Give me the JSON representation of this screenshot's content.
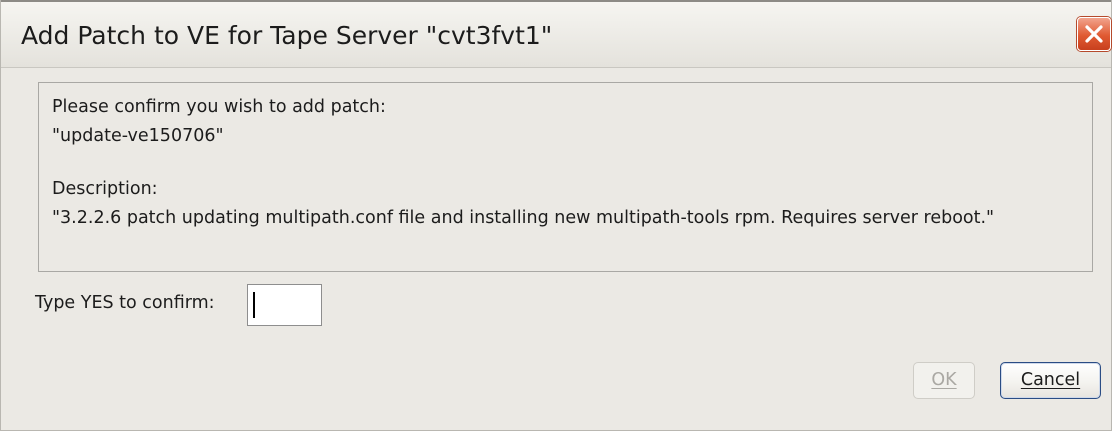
{
  "window": {
    "title": "Add Patch to VE for Tape Server \"cvt3fvt1\"",
    "close_icon": "close-icon",
    "close_color": "#e05a32"
  },
  "message": {
    "prompt": "Please confirm you wish to add patch:",
    "patch_name": "\"update-ve150706\"",
    "description_label": "Description:",
    "description": "\"3.2.2.6 patch updating multipath.conf file and installing new multipath-tools rpm. Requires server reboot.\""
  },
  "confirm": {
    "label": "Type YES to confirm:",
    "value": ""
  },
  "buttons": {
    "ok_label": "OK",
    "cancel_label": "Cancel"
  }
}
